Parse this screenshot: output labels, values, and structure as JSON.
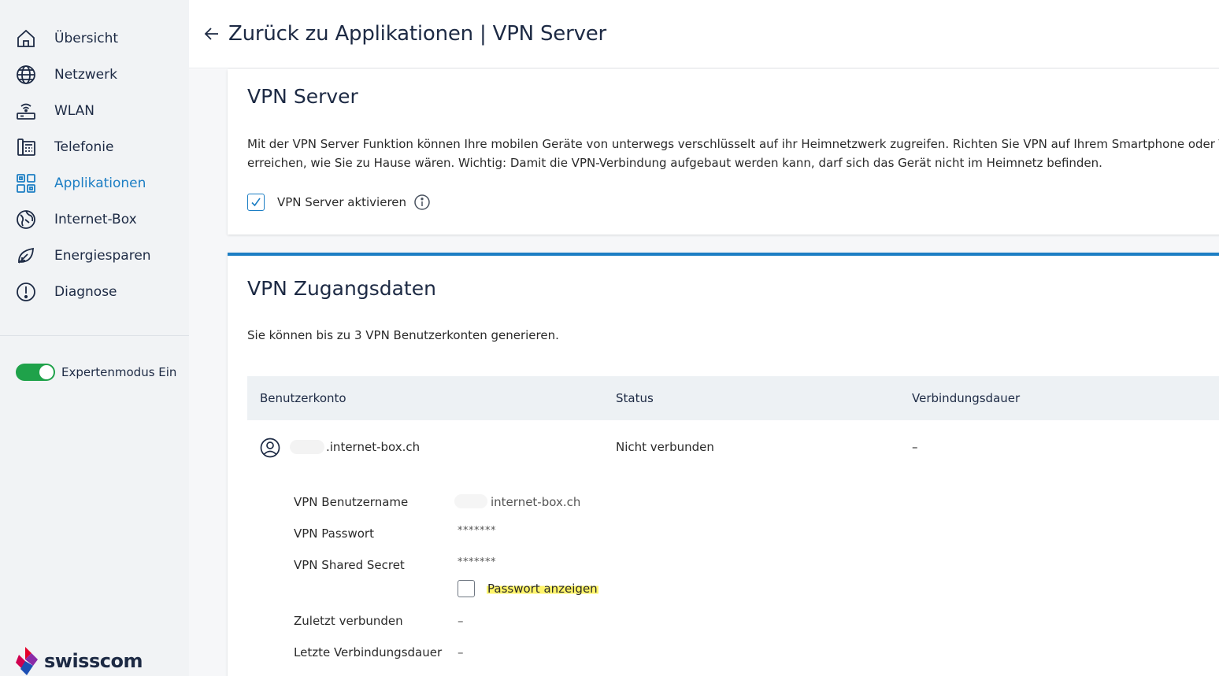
{
  "sidebar": {
    "items": [
      {
        "label": "Übersicht",
        "icon": "home-icon"
      },
      {
        "label": "Netzwerk",
        "icon": "globe-icon"
      },
      {
        "label": "WLAN",
        "icon": "router-wifi-icon"
      },
      {
        "label": "Telefonie",
        "icon": "phone-icon"
      },
      {
        "label": "Applikationen",
        "icon": "apps-grid-icon",
        "active": true
      },
      {
        "label": "Internet-Box",
        "icon": "internet-box-icon"
      },
      {
        "label": "Energiesparen",
        "icon": "leaf-icon"
      },
      {
        "label": "Diagnose",
        "icon": "alert-icon"
      }
    ],
    "expert_mode": {
      "label": "Expertenmodus Ein",
      "on": true
    },
    "logo_text": "swisscom"
  },
  "header": {
    "back_label": "Zurück zu Applikationen | VPN Server"
  },
  "vpn_server": {
    "title": "VPN Server",
    "description_line1": "Mit der VPN Server Funktion können Ihre mobilen Geräte von unterwegs verschlüsselt auf ihr Heimnetzwerk zugreifen. Richten Sie VPN auf Ihrem Smartphone oder Tablet ein und s",
    "description_line2": "erreichen, wie Sie zu Hause wären. Wichtig: Damit die VPN-Verbindung aufgebaut werden kann, darf sich das Gerät nicht im Heimnetz befinden.",
    "activate_label": "VPN Server aktivieren",
    "activate_checked": true
  },
  "vpn_credentials": {
    "title": "VPN Zugangsdaten",
    "subtitle": "Sie können bis zu 3 VPN Benutzerkonten generieren.",
    "columns": [
      "Benutzerkonto",
      "Status",
      "Verbindungsdauer"
    ],
    "account": {
      "name": ".internet-box.ch",
      "status": "Nicht verbunden",
      "duration": "–"
    },
    "details": {
      "username_label": "VPN Benutzername",
      "username_value": "internet-box.ch",
      "password_label": "VPN Passwort",
      "password_value": "*******",
      "secret_label": "VPN Shared Secret",
      "secret_value": "*******",
      "show_password_label": "Passwort anzeigen",
      "last_connected_label": "Zuletzt verbunden",
      "last_connected_value": "–",
      "last_duration_label": "Letzte Verbindungsdauer",
      "last_duration_value": "–"
    }
  },
  "colors": {
    "accent": "#1c7ec4",
    "toggle_on": "#1fa24a",
    "highlight": "#fff46a"
  }
}
